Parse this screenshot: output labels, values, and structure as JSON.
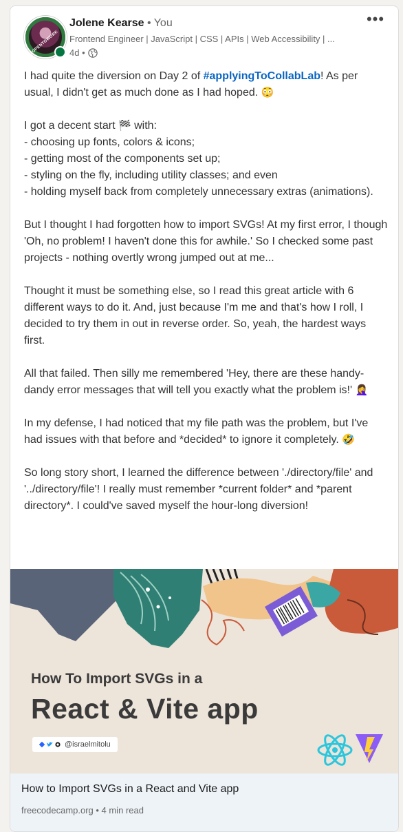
{
  "post": {
    "author_name": "Jolene Kearse",
    "author_relation": " • You",
    "headline": "Frontend Engineer | JavaScript | CSS | APIs | Web Accessibility | ...",
    "time": "4d •",
    "avatar_ring_text": "#OPENTOWORK",
    "more_label": "•••",
    "paragraphs": {
      "p1_before": "I had quite the diversion on Day 2 of ",
      "p1_hashtag": "#applyingToCollabLab",
      "p1_after": "! As per usual, I didn't get as much done as I had hoped. ",
      "p1_emoji": "😳",
      "p2_line1": "I got a decent start ",
      "p2_emoji": "🏁",
      "p2_line1_end": " with:",
      "p2_line2": "- choosing up fonts, colors & icons;",
      "p2_line3": "- getting most of the components set up;",
      "p2_line4": "- styling on the fly, including utility classes; and even",
      "p2_line5": "- holding myself back from completely unnecessary extras (animations).",
      "p3": "But I thought I had forgotten how to import SVGs! At my first error, I though 'Oh, no problem! I haven't done this for awhile.' So I checked some past projects - nothing overtly wrong jumped out at me...",
      "p4": "Thought it must be something else, so I read this great article with 6 different ways to do it. And, just because I'm me and that's how I roll, I decided to try them in out in reverse order. So, yeah, the hardest ways first.",
      "p5": "All that failed. Then silly me remembered 'Hey, there are these handy-dandy error messages that will tell you exactly what the problem is!' ",
      "p5_emoji": "🤦‍♀️",
      "p6": "In my defense, I had noticed that my file path was the problem, but I've had issues with that before and *decided* to ignore it completely. ",
      "p6_emoji": "🤣",
      "p7": "So long story short, I learned the difference between './directory/file' and '../directory/file'! I really must remember *current folder* and *parent directory*. I could've saved myself the hour-long diversion!"
    }
  },
  "article": {
    "image_title_small": "How To Import SVGs in a",
    "image_title_large": "React & Vite app",
    "image_handle": "@israelmitolu",
    "link_title": "How to Import SVGs in a React and Vite app",
    "link_source": "freecodecamp.org • 4 min read"
  },
  "colors": {
    "link_blue": "#0a66c2",
    "online_green": "#057642",
    "open_to_work_green": "#2f7a3e",
    "link_footer_bg": "#eef3f8"
  },
  "icons": [
    "globe-icon",
    "more-options-icon",
    "react-logo-icon",
    "vite-logo-icon",
    "hashnode-icon",
    "twitter-icon",
    "github-icon"
  ]
}
